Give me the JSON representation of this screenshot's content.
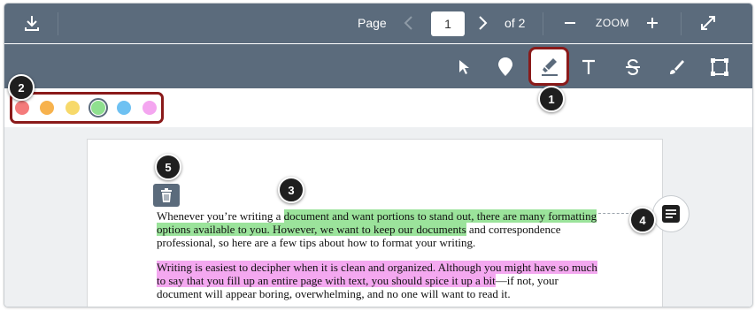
{
  "topbar": {
    "download_icon": "download-icon",
    "page_label": "Page",
    "page_value": "1",
    "page_total": "of 2",
    "zoom_label": "ZOOM",
    "prev_icon": "chevron-left-icon",
    "next_icon": "chevron-right-icon",
    "zoom_out_icon": "minus-icon",
    "zoom_in_icon": "plus-icon",
    "fullscreen_icon": "expand-icon"
  },
  "toolbar": {
    "tools": [
      "select-tool",
      "point-annotation-tool",
      "highlight-tool",
      "text-tool",
      "strikeout-tool",
      "freehand-tool",
      "area-tool"
    ],
    "active_tool": "highlight-tool"
  },
  "palette": {
    "colors": [
      "#f47b7b",
      "#f7b24d",
      "#f7d96a",
      "#8fe08f",
      "#6ec1f2",
      "#f4a6f0"
    ],
    "selected_index": 3
  },
  "callouts": [
    "1",
    "2",
    "3",
    "4",
    "5"
  ],
  "document": {
    "para1_line1_pre": "Whenever you’re writing a ",
    "para1_line1_hl": "document and want portions to stand out, there are many formatting",
    "para1_line2_hl": "options available to you. However, we want to keep our documents",
    "para1_line2_post": " and correspondence",
    "para1_line3": "professional, so here are a few tips about how to format your writing.",
    "para2_line1_hl": "Writing is easiest to decipher when it is clean and organized. Although you might have so much",
    "para2_line2_hl": "to say that you fill up an entire page with text, you should spice it up a bit",
    "para2_line2_post": "—if not, your",
    "para2_line3": "document will appear boring, overwhelming, and no one will want to read it."
  },
  "colors": {
    "toolbar_bg": "#5b6b7c",
    "callout_border": "#8a1a1a",
    "highlight_green": "#9be39b",
    "highlight_pink": "#f4a8f0"
  }
}
